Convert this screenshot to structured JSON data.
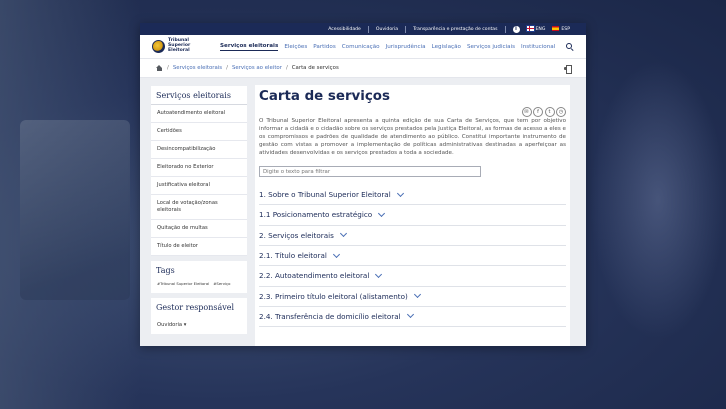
{
  "topbar": {
    "links": [
      "Acessibilidade",
      "Ouvidoria",
      "Transparência e prestação de contas"
    ],
    "lang_en": "ENG",
    "lang_es": "ESP"
  },
  "header": {
    "logo_lines": [
      "Tribunal",
      "Superior",
      "Eleitoral"
    ],
    "nav": [
      "Serviços eleitorais",
      "Eleições",
      "Partidos",
      "Comunicação",
      "Jurisprudência",
      "Legislação",
      "Serviços judiciais",
      "Institucional"
    ],
    "active_nav": "Serviços eleitorais"
  },
  "breadcrumb": [
    "Serviços eleitorais",
    "Serviços ao eleitor",
    "Carta de serviços"
  ],
  "sidebar": {
    "title": "Serviços eleitorais",
    "items": [
      "Autoatendimento eleitoral",
      "Certidões",
      "Desincompatibilização",
      "Eleitorado no Exterior",
      "Justificativa eleitoral",
      "Local de votação/zonas eleitorais",
      "Quitação de multas",
      "Título de eleitor"
    ],
    "tags_title": "Tags",
    "tags": [
      "#Tribunal Superior Eleitoral",
      "#Serviço"
    ],
    "gestor_title": "Gestor responsável",
    "gestor_item": "Ouvidoria"
  },
  "content": {
    "title": "Carta de serviços",
    "intro": "O Tribunal Superior Eleitoral apresenta a quinta edição de sua Carta de Serviços, que tem por objetivo informar a cidadã e o cidadão sobre os serviços prestados pela Justiça Eleitoral, as formas de acesso a eles e os compromissos e padrões de qualidade de atendimento ao público. Constitui importante instrumento de gestão com vistas a promover a implementação de políticas administrativas destinadas a aperfeiçoar as atividades desenvolvidas e os serviços prestados a toda a sociedade.",
    "filter_placeholder": "Digite o texto para filtrar",
    "sections": [
      "1. Sobre o Tribunal Superior Eleitoral",
      "1.1 Posicionamento estratégico",
      "2. Serviços eleitorais",
      "2.1. Título eleitoral",
      "2.2. Autoatendimento eleitoral",
      "2.3. Primeiro título eleitoral (alistamento)",
      "2.4. Transferência de domicílio eleitoral"
    ]
  },
  "colors": {
    "primary": "#1b2a57",
    "link": "#4a6fb5"
  }
}
